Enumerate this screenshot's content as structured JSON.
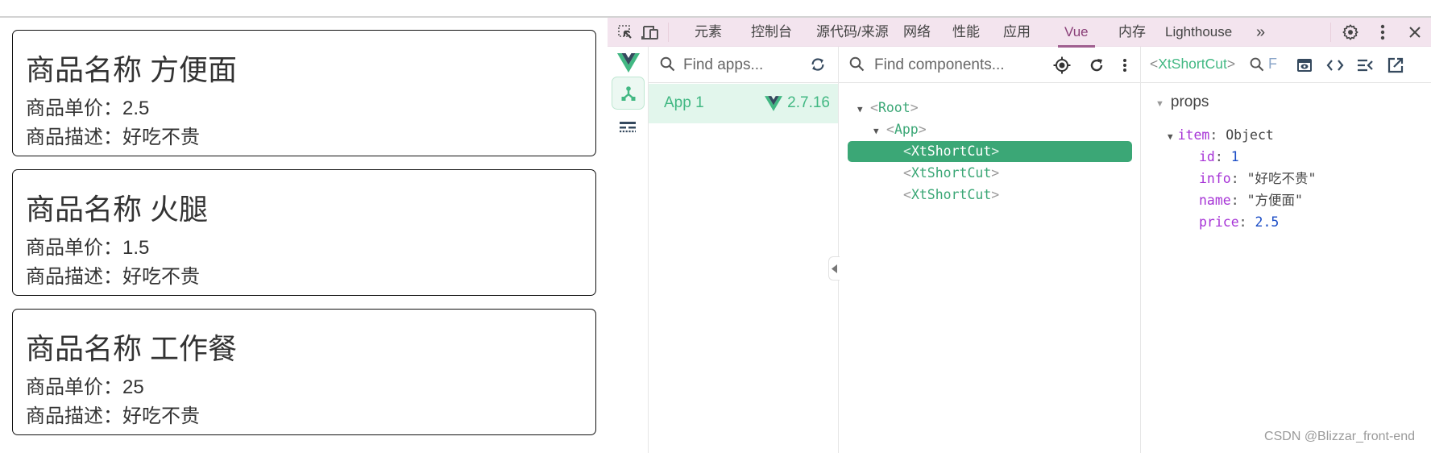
{
  "page": {
    "cards": [
      {
        "title": "商品名称 方便面",
        "price_line": "商品单价：2.5",
        "desc_line": "商品描述：好吃不贵"
      },
      {
        "title": "商品名称 火腿",
        "price_line": "商品单价：1.5",
        "desc_line": "商品描述：好吃不贵"
      },
      {
        "title": "商品名称 工作餐",
        "price_line": "商品单价：25",
        "desc_line": "商品描述：好吃不贵"
      }
    ]
  },
  "devtools": {
    "toolbar": {
      "tabs": [
        {
          "label": "元素"
        },
        {
          "label": "控制台"
        },
        {
          "label": "源代码/来源"
        },
        {
          "label": "网络"
        },
        {
          "label": "性能"
        },
        {
          "label": "应用"
        },
        {
          "label": "Vue",
          "active": true
        },
        {
          "label": "内存"
        },
        {
          "label": "Lighthouse"
        }
      ],
      "more_label": "»",
      "icons": [
        "inspect-element-icon",
        "device-toggle-icon",
        "settings-gear-icon",
        "more-vertical-icon",
        "close-icon"
      ]
    },
    "apps": {
      "search_placeholder": "Find apps...",
      "items": [
        {
          "name": "App 1",
          "version": "2.7.16"
        }
      ]
    },
    "components": {
      "search_placeholder": "Find components...",
      "tree": [
        {
          "name": "Root",
          "open_bracket": "<",
          "close_bracket": ">",
          "expanded": true,
          "level": 0
        },
        {
          "name": "App",
          "open_bracket": "<",
          "close_bracket": ">",
          "expanded": true,
          "level": 1
        },
        {
          "name": "XtShortCut",
          "open_bracket": "<",
          "close_bracket": ">",
          "selected": true,
          "level": 2
        },
        {
          "name": "XtShortCut",
          "open_bracket": "<",
          "close_bracket": ">",
          "level": 2
        },
        {
          "name": "XtShortCut",
          "open_bracket": "<",
          "close_bracket": ">",
          "level": 2
        }
      ]
    },
    "inspector": {
      "title_open": "<",
      "title_name": "XtShortCut",
      "title_close": ">",
      "filter_value": "F",
      "section": "props",
      "item_key": "item",
      "item_type": "Object",
      "fields": [
        {
          "key": "id",
          "value": "1",
          "kind": "number"
        },
        {
          "key": "info",
          "value": "\"好吃不贵\"",
          "kind": "string"
        },
        {
          "key": "name",
          "value": "\"方便面\"",
          "kind": "string"
        },
        {
          "key": "price",
          "value": "2.5",
          "kind": "number"
        }
      ]
    },
    "colors": {
      "vue_green": "#42b883",
      "selected_row": "#3ba776",
      "toolbar_bg": "#f3e4ee",
      "active_tab": "#8a3f78",
      "prop_key": "#a633d6",
      "prop_number": "#1d4ec6"
    }
  },
  "watermark": "CSDN @Blizzar_front-end"
}
